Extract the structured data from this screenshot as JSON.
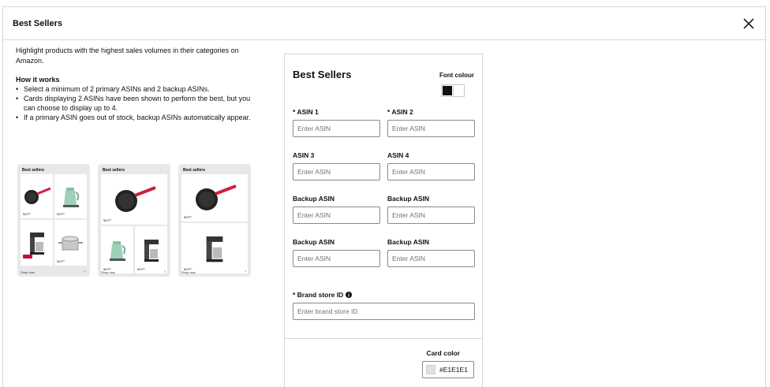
{
  "modal": {
    "title": "Best Sellers"
  },
  "left": {
    "intro": "Highlight products with the highest sales volumes in their categories on Amazon.",
    "how_title": "How it works",
    "how_items": [
      "Select a minimum of 2 primary ASINs and 2 backup ASINs.",
      "Cards displaying 2 ASINs have been shown to perform the best, but you can choose to display up to 4.",
      "If a primary ASIN goes out of stock, backup ASINs automatically appear."
    ]
  },
  "previews": {
    "card_title": "Best sellers",
    "shop_now": "Shop now",
    "price": "$00⁰⁰"
  },
  "form": {
    "title": "Best Sellers",
    "font_colour_label": "Font colour",
    "colors": {
      "black": "#111111",
      "white": "#ffffff"
    },
    "fields": [
      {
        "label": "* ASIN 1",
        "placeholder": "Enter ASIN"
      },
      {
        "label": "* ASIN 2",
        "placeholder": "Enter ASIN"
      },
      {
        "label": "ASIN 3",
        "placeholder": "Enter ASIN"
      },
      {
        "label": "ASIN 4",
        "placeholder": "Enter ASIN"
      },
      {
        "label": "Backup ASIN",
        "placeholder": "Enter ASIN"
      },
      {
        "label": "Backup ASIN",
        "placeholder": "Enter ASIN"
      },
      {
        "label": "Backup ASIN",
        "placeholder": "Enter ASIN"
      },
      {
        "label": "Backup ASIN",
        "placeholder": "Enter ASIN"
      }
    ],
    "brand_store": {
      "label": "* Brand store ID",
      "placeholder": "Enter brand store ID"
    },
    "card_color": {
      "label": "Card color",
      "value": "#E1E1E1"
    }
  }
}
